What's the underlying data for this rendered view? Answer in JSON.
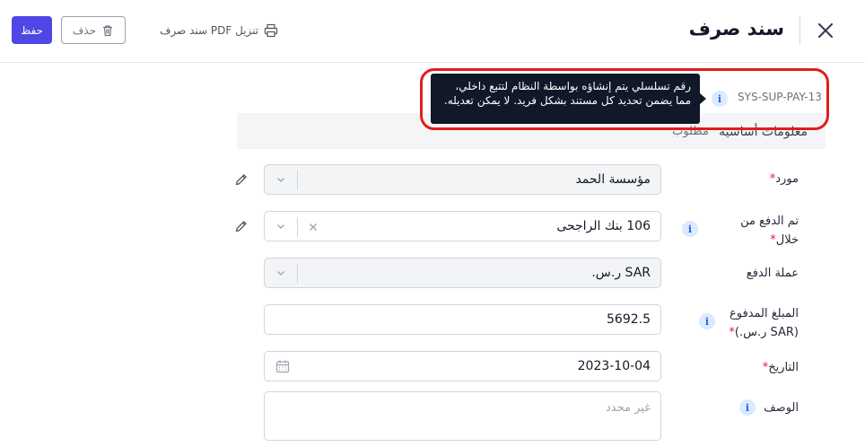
{
  "header": {
    "title": "سند صرف",
    "pdf_label": "تنزيل PDF سند صرف",
    "delete_label": "حذف",
    "save_label": "حفظ"
  },
  "serial": {
    "value": "SYS-SUP-PAY-13",
    "tooltip": "رقم تسلسلي يتم إنشاؤه بواسطة النظام لتتبع داخلي، مما يضمن تحديد كل مستند بشكل فريد. لا يمكن تعديله."
  },
  "section": {
    "title": "معلومات أساسية",
    "subtitle": "مطلوب"
  },
  "form": {
    "supplier": {
      "label": "مورد",
      "required_mark": "*",
      "value": "مؤسسة الحمد"
    },
    "paid_via": {
      "label_line1": "تم الدفع من",
      "label_line2": "خلال",
      "required_mark": "*",
      "value": "106 بنك الراجحى"
    },
    "currency": {
      "label": "عملة الدفع",
      "value": "SAR ر.س."
    },
    "amount": {
      "label_line1": "المبلغ المدفوع",
      "label_line2": "(SAR ر.س.)",
      "required_mark": "*",
      "value": "5692.5"
    },
    "date": {
      "label": "التاريخ",
      "required_mark": "*",
      "value": "2023-10-04"
    },
    "description": {
      "label": "الوصف",
      "placeholder": "غير محدد"
    }
  },
  "colors": {
    "primary": "#4f46e5",
    "highlight": "#e11d1d",
    "tooltip_bg": "#111827",
    "info_bg": "#dbeafe",
    "required": "#e11d48"
  },
  "icons": [
    "close-icon",
    "printer-icon",
    "trash-icon",
    "info-icon",
    "pencil-icon",
    "chevron-down-icon",
    "clear-x-icon",
    "calendar-icon"
  ]
}
